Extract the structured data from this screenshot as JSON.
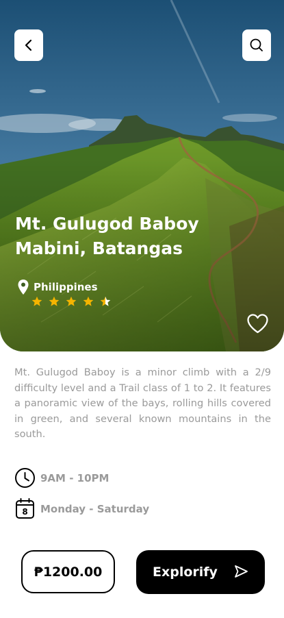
{
  "destination": {
    "title_line1": "Mt. Gulugod Baboy",
    "title_line2": "Mabini, Batangas",
    "country": "Philippines",
    "rating": 4.5,
    "max_rating": 5,
    "favorited": false
  },
  "description": "Mt. Gulugod Baboy is a minor climb with a 2/9 difficulty level and a Trail class of 1 to 2. It features a panoramic view of the bays, rolling hills covered in green, and several known mountains in the south.",
  "schedule": {
    "hours": "9AM - 10PM",
    "days": "Monday - Saturday",
    "calendar_day": "8"
  },
  "actions": {
    "price": "₱1200.00",
    "primary_label": "Explorify"
  },
  "icons": {
    "back": "chevron-left-icon",
    "search": "search-icon",
    "location": "location-pin-icon",
    "star": "star-icon",
    "favorite": "heart-icon",
    "clock": "clock-icon",
    "calendar": "calendar-icon",
    "send": "send-icon"
  },
  "colors": {
    "star": "#f5b400",
    "primary_button": "#000000",
    "muted_text": "#9a9a9a"
  }
}
